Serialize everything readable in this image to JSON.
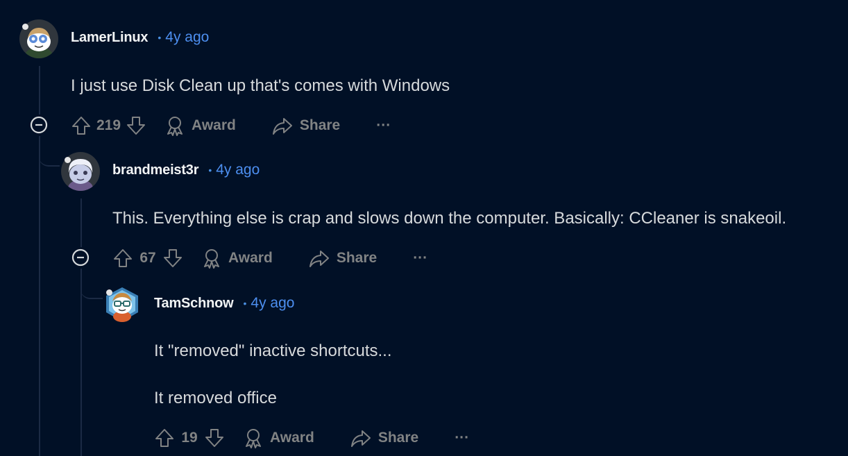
{
  "comments": [
    {
      "username": "LamerLinux",
      "timestamp": "4y ago",
      "body": [
        "I just use Disk Clean up that's comes with Windows"
      ],
      "score": "219",
      "award_label": "Award",
      "share_label": "Share",
      "more_label": "···"
    },
    {
      "username": "brandmeist3r",
      "timestamp": "4y ago",
      "body": [
        "This. Everything else is crap and slows down the computer. Basically: CCleaner is snakeoil."
      ],
      "score": "67",
      "award_label": "Award",
      "share_label": "Share",
      "more_label": "···"
    },
    {
      "username": "TamSchnow",
      "timestamp": "4y ago",
      "body": [
        "It \"removed\" inactive shortcuts...",
        "It removed office"
      ],
      "score": "19",
      "award_label": "Award",
      "share_label": "Share",
      "more_label": "···"
    }
  ],
  "separator": "•",
  "colors": {
    "background": "#011026",
    "username": "#f2f4f5",
    "timestamp": "#4d8ff0",
    "muted": "#818384",
    "thread_line": "#1b2a44"
  }
}
